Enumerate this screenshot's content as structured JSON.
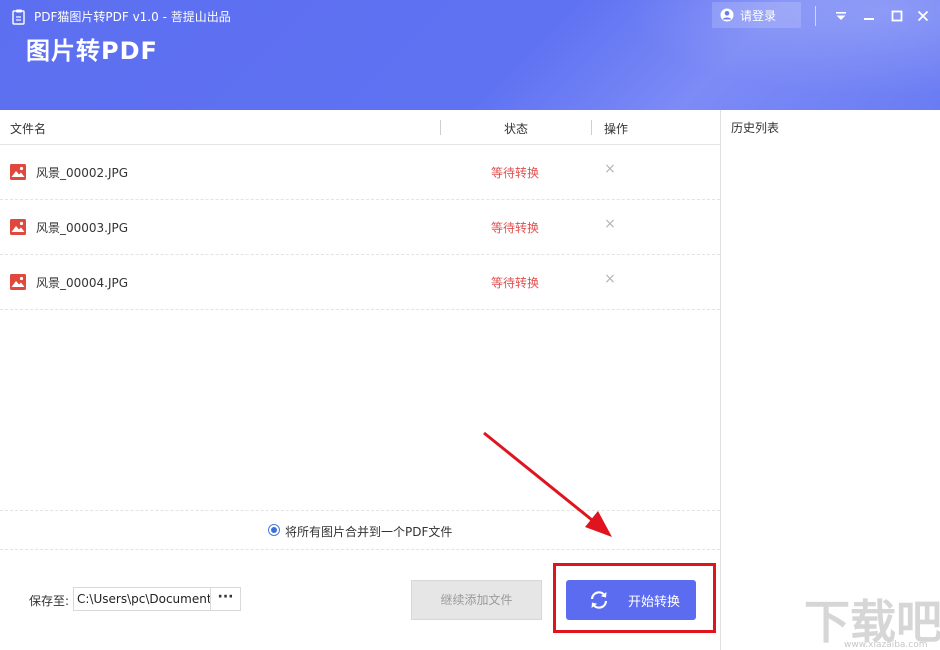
{
  "window": {
    "title": "PDF猫图片转PDF v1.0 - 菩提山出品",
    "heading": "图片转PDF",
    "login_label": "请登录"
  },
  "table": {
    "columns": [
      "文件名",
      "状态",
      "操作"
    ],
    "rows": [
      {
        "name": "风景_00002.JPG",
        "status": "等待转换",
        "action_icon": "close-icon"
      },
      {
        "name": "风景_00003.JPG",
        "status": "等待转换",
        "action_icon": "close-icon"
      },
      {
        "name": "风景_00004.JPG",
        "status": "等待转换",
        "action_icon": "close-icon"
      }
    ]
  },
  "options": {
    "merge_label": "将所有图片合并到一个PDF文件",
    "merge_checked": true
  },
  "save": {
    "label": "保存至:",
    "path": "C:\\Users\\pc\\Documents",
    "browse_label": "···"
  },
  "buttons": {
    "add_files": "继续添加文件",
    "start": "开始转换"
  },
  "history": {
    "title": "历史列表"
  },
  "colors": {
    "accent": "#5b6cf0",
    "header": "#5f72f2",
    "status": "#e05050",
    "annotation": "#e0141e"
  },
  "watermark": {
    "text": "下载吧",
    "url": "www.xiazaiba.com"
  }
}
